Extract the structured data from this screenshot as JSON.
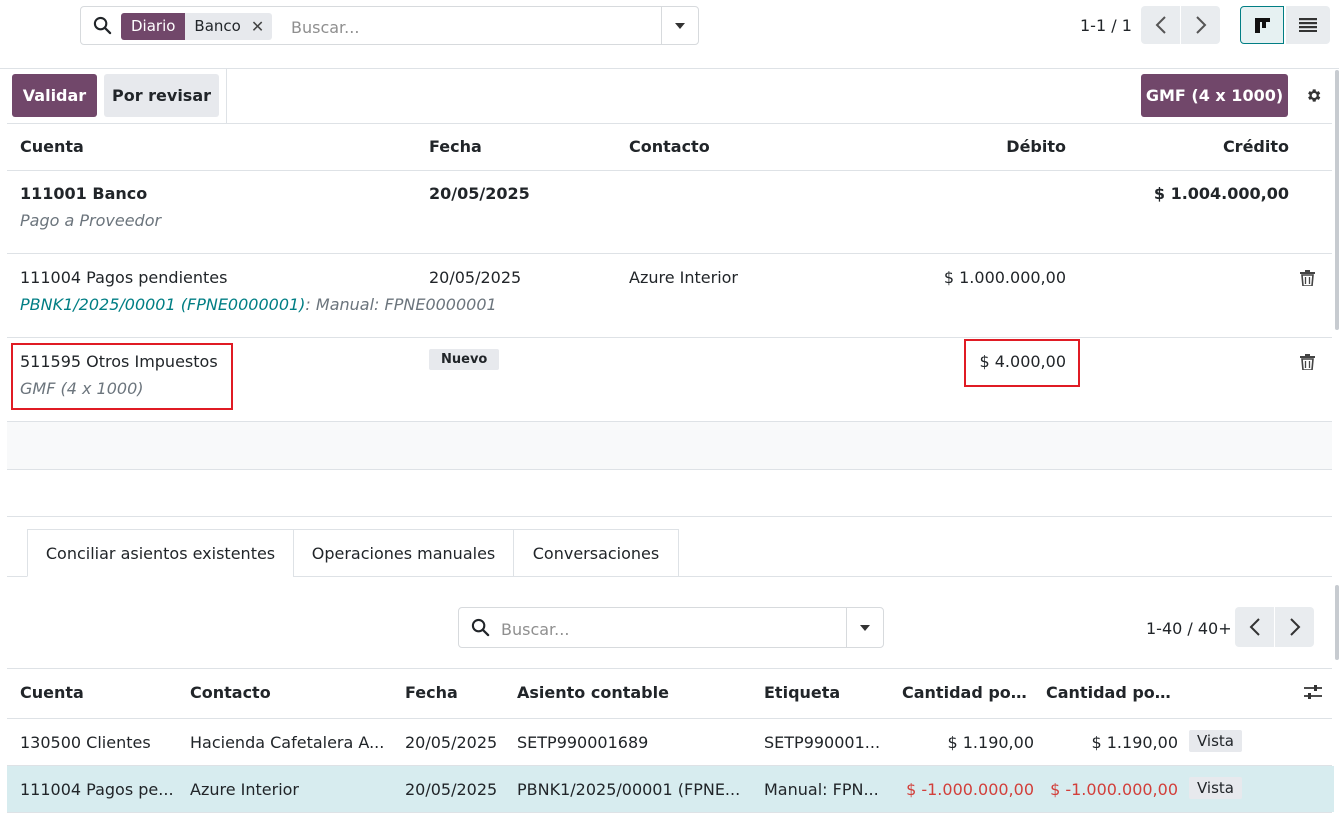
{
  "search": {
    "facet_label": "Diario",
    "facet_value": "Banco",
    "placeholder": "Buscar..."
  },
  "pager": {
    "text": "1-1 / 1"
  },
  "buttons": {
    "validate": "Validar",
    "review": "Por revisar",
    "gmf": "GMF (4 x 1000)"
  },
  "entry_table": {
    "headers": {
      "account": "Cuenta",
      "date": "Fecha",
      "contact": "Contacto",
      "debit": "Débito",
      "credit": "Crédito"
    },
    "rows": [
      {
        "account": "111001 Banco",
        "subtitle": "Pago a Proveedor",
        "date": "20/05/2025",
        "contact": "",
        "debit": "",
        "credit": "$ 1.004.000,00"
      },
      {
        "account": "111004 Pagos pendientes",
        "ref": "PBNK1/2025/00001 (FPNE0000001)",
        "subtitle": ": Manual: FPNE0000001",
        "date": "20/05/2025",
        "contact": "Azure Interior",
        "debit": "$ 1.000.000,00",
        "credit": ""
      },
      {
        "account": "511595 Otros Impuestos",
        "subtitle": "GMF (4 x 1000)",
        "badge": "Nuevo",
        "debit": "$ 4.000,00",
        "credit": ""
      }
    ]
  },
  "tabs": [
    {
      "label": "Conciliar asientos existentes",
      "active": true
    },
    {
      "label": "Operaciones manuales",
      "active": false
    },
    {
      "label": "Conversaciones",
      "active": false
    }
  ],
  "lower": {
    "search_placeholder": "Buscar...",
    "pager_text": "1-40 / 40+",
    "headers": {
      "account": "Cuenta",
      "contact": "Contacto",
      "date": "Fecha",
      "move": "Asiento contable",
      "label": "Etiqueta",
      "amount1": "Cantidad por ...",
      "amount2": "Cantidad por ..."
    },
    "rows": [
      {
        "account": "130500 Clientes",
        "contact": "Hacienda Cafetalera A...",
        "date": "20/05/2025",
        "move": "SETP990001689",
        "label": "SETP990001...",
        "amount1": "$ 1.190,00",
        "amount2": "$ 1.190,00",
        "action": "Vista"
      },
      {
        "account": "111004 Pagos pe...",
        "contact": "Azure Interior",
        "date": "20/05/2025",
        "move": "PBNK1/2025/00001 (FPNE...",
        "label": "Manual: FPN...",
        "amount1": "$ -1.000.000,00",
        "amount2": "$ -1.000.000,00",
        "action": "Vista"
      }
    ]
  },
  "colors": {
    "primary": "#71476a",
    "highlight": "#d7ecef",
    "negative": "#d23f3a",
    "teal": "#017e84",
    "red_box": "#e01b24"
  }
}
